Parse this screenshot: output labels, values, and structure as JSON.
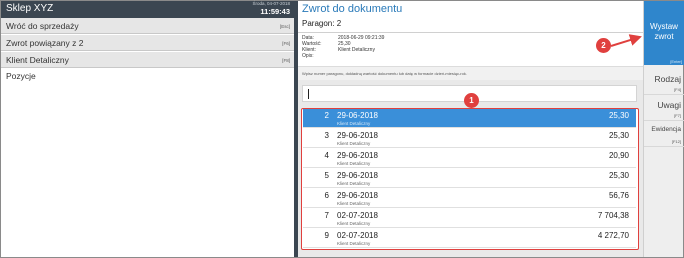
{
  "header": {
    "app_title": "Sklep XYZ",
    "date": "Środa, 04-07-2018",
    "time": "11:59:43"
  },
  "left_menu": [
    {
      "label": "Wróć do sprzedaży",
      "key": "[Esc]"
    },
    {
      "label": "Zwrot powiązany z 2",
      "key": "[F6]"
    },
    {
      "label": "Klient Detaliczny",
      "key": "[F8]"
    }
  ],
  "left_section": "Pozycje",
  "document": {
    "title": "Zwrot do dokumentu",
    "receipt": "Paragon: 2",
    "fields": [
      {
        "label": "Data:",
        "value": "2018-06-29 09:21:39"
      },
      {
        "label": "Wartość:",
        "value": "25,30"
      },
      {
        "label": "Klient:",
        "value": "Klient Detaliczny"
      },
      {
        "label": "Opis:",
        "value": ""
      }
    ],
    "hint": "Wpisz numer paragonu, dokładną wartość dokumentu lub datę w formacie dzień-miesiąc-rok.",
    "search_value": ""
  },
  "receipts": [
    {
      "num": "2",
      "date": "29-06-2018",
      "client": "Klient Detaliczny",
      "amount": "25,30",
      "selected": true
    },
    {
      "num": "3",
      "date": "29-06-2018",
      "client": "Klient Detaliczny",
      "amount": "25,30",
      "selected": false
    },
    {
      "num": "4",
      "date": "29-06-2018",
      "client": "Klient Detaliczny",
      "amount": "20,90",
      "selected": false
    },
    {
      "num": "5",
      "date": "29-06-2018",
      "client": "Klient Detaliczny",
      "amount": "25,30",
      "selected": false
    },
    {
      "num": "6",
      "date": "29-06-2018",
      "client": "Klient Detaliczny",
      "amount": "56,76",
      "selected": false
    },
    {
      "num": "7",
      "date": "02-07-2018",
      "client": "Klient Detaliczny",
      "amount": "7 704,38",
      "selected": false
    },
    {
      "num": "9",
      "date": "02-07-2018",
      "client": "Klient Detaliczny",
      "amount": "4 272,70",
      "selected": false
    }
  ],
  "right_panel": {
    "issue": {
      "line1": "Wystaw",
      "line2": "zwrot",
      "key": "[Enter]"
    },
    "buttons": [
      {
        "label": "Rodzaj",
        "key": "[F4]"
      },
      {
        "label": "Uwagi",
        "key": "[F7]"
      },
      {
        "label": "Ewidencja",
        "key": "[F12]"
      }
    ]
  },
  "annotations": {
    "badge1": "1",
    "badge2": "2"
  },
  "colors": {
    "accent": "#2f86cc",
    "selection": "#3a8fd9",
    "annotation": "#e0403e",
    "header": "#3b4651"
  }
}
